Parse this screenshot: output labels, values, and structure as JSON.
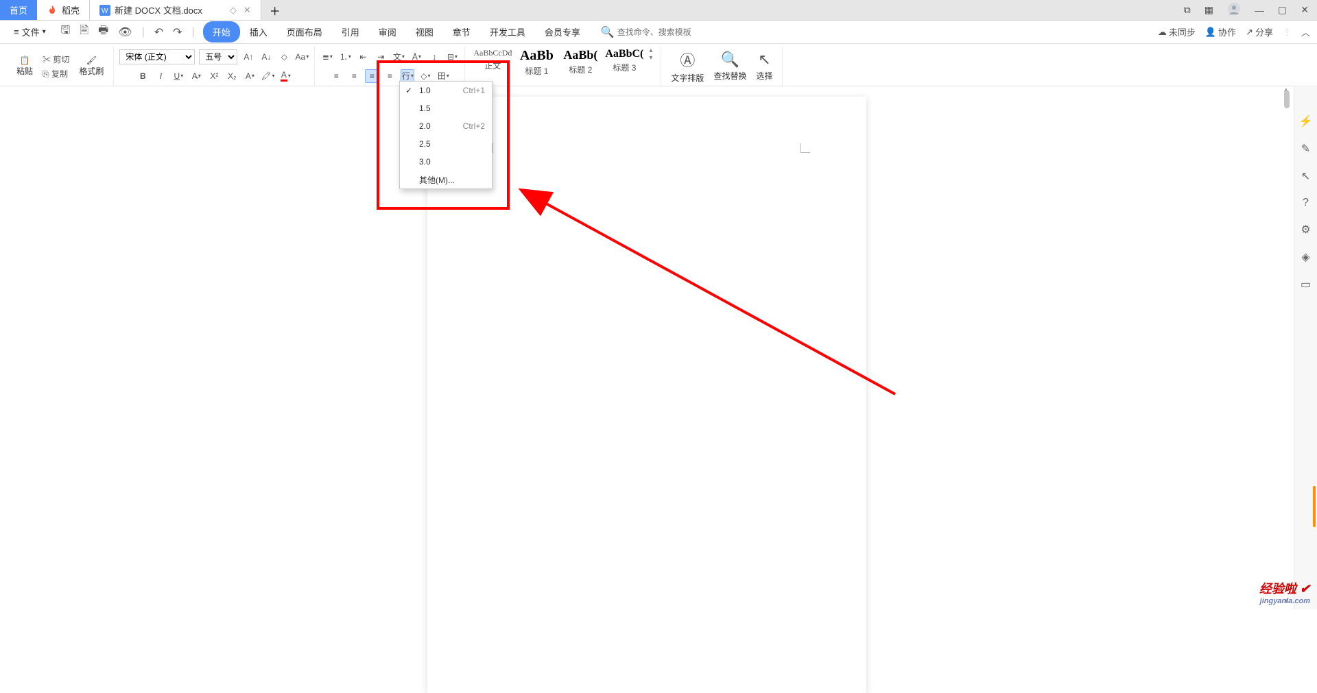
{
  "tabs": {
    "home": "首页",
    "docke": "稻壳",
    "doc": "新建 DOCX 文档.docx"
  },
  "file_menu": "文件",
  "menu": [
    "开始",
    "插入",
    "页面布局",
    "引用",
    "审阅",
    "视图",
    "章节",
    "开发工具",
    "会员专享"
  ],
  "search_placeholder": "查找命令、搜索模板",
  "right_actions": {
    "sync": "未同步",
    "collab": "协作",
    "share": "分享"
  },
  "clipboard": {
    "paste": "粘贴",
    "cut": "剪切",
    "copy": "复制",
    "brush": "格式刷"
  },
  "font": {
    "name": "宋体 (正文)",
    "size": "五号"
  },
  "styles": {
    "normal_prev": "AaBbCcDd",
    "normal": "正文",
    "h1_prev": "AaBb",
    "h1": "标题 1",
    "h2_prev": "AaBb(",
    "h2": "标题 2",
    "h3_prev": "AaBbC(",
    "h3": "标题 3"
  },
  "bigbtn": {
    "layout": "文字排版",
    "find": "查找替换",
    "select": "选择"
  },
  "dropdown": {
    "i1": "1.0",
    "s1": "Ctrl+1",
    "i2": "1.5",
    "i3": "2.0",
    "s3": "Ctrl+2",
    "i4": "2.5",
    "i5": "3.0",
    "other": "其他(M)..."
  },
  "watermark": {
    "l1": "经验啦",
    "l2": "jingyanla.com"
  }
}
